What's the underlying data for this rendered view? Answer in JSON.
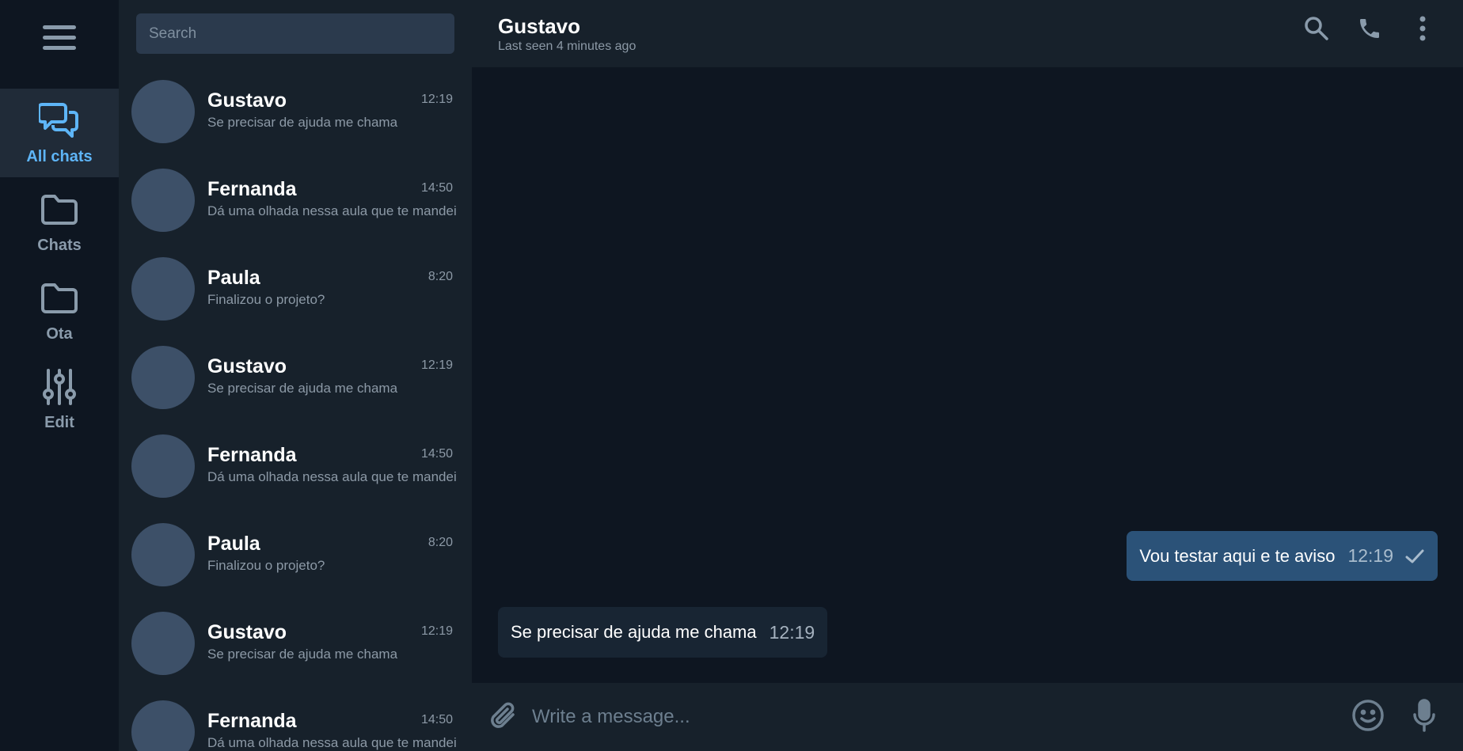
{
  "rail": {
    "menu_icon": "hamburger-menu-icon",
    "items": [
      {
        "label": "All chats",
        "icon": "chat-bubbles-icon",
        "active": true
      },
      {
        "label": "Chats",
        "icon": "folder-icon",
        "active": false
      },
      {
        "label": "Ota",
        "icon": "folder-icon",
        "active": false
      },
      {
        "label": "Edit",
        "icon": "sliders-icon",
        "active": false
      }
    ]
  },
  "search": {
    "placeholder": "Search",
    "value": ""
  },
  "chats": [
    {
      "name": "Gustavo",
      "time": "12:19",
      "preview": "Se precisar de ajuda me chama"
    },
    {
      "name": "Fernanda",
      "time": "14:50",
      "preview": "Dá uma olhada nessa aula que te mandei"
    },
    {
      "name": "Paula",
      "time": "8:20",
      "preview": "Finalizou o projeto?"
    },
    {
      "name": "Gustavo",
      "time": "12:19",
      "preview": "Se precisar de ajuda me chama"
    },
    {
      "name": "Fernanda",
      "time": "14:50",
      "preview": "Dá uma olhada nessa aula que te mandei"
    },
    {
      "name": "Paula",
      "time": "8:20",
      "preview": "Finalizou o projeto?"
    },
    {
      "name": "Gustavo",
      "time": "12:19",
      "preview": "Se precisar de ajuda me chama"
    },
    {
      "name": "Fernanda",
      "time": "14:50",
      "preview": "Dá uma olhada nessa aula que te mandei"
    }
  ],
  "conversation": {
    "title": "Gustavo",
    "status": "Last seen 4 minutes ago",
    "header_icons": [
      "search-icon",
      "phone-icon",
      "more-vertical-icon"
    ],
    "messages": [
      {
        "direction": "out",
        "text": "Vou testar aqui e te aviso",
        "time": "12:19",
        "status_icon": "check-icon"
      },
      {
        "direction": "in",
        "text": "Se precisar de ajuda me chama",
        "time": "12:19"
      }
    ],
    "composer": {
      "placeholder": "Write a message...",
      "value": "",
      "icons": [
        "paperclip-icon",
        "emoji-icon",
        "microphone-icon"
      ]
    }
  },
  "colors": {
    "accent": "#5eb5f7",
    "sidebar_bg": "#0e1621",
    "panel_bg": "#17212b",
    "outgoing_bubble": "#2b5278",
    "incoming_bubble": "#182533",
    "avatar": "#3d5068"
  }
}
